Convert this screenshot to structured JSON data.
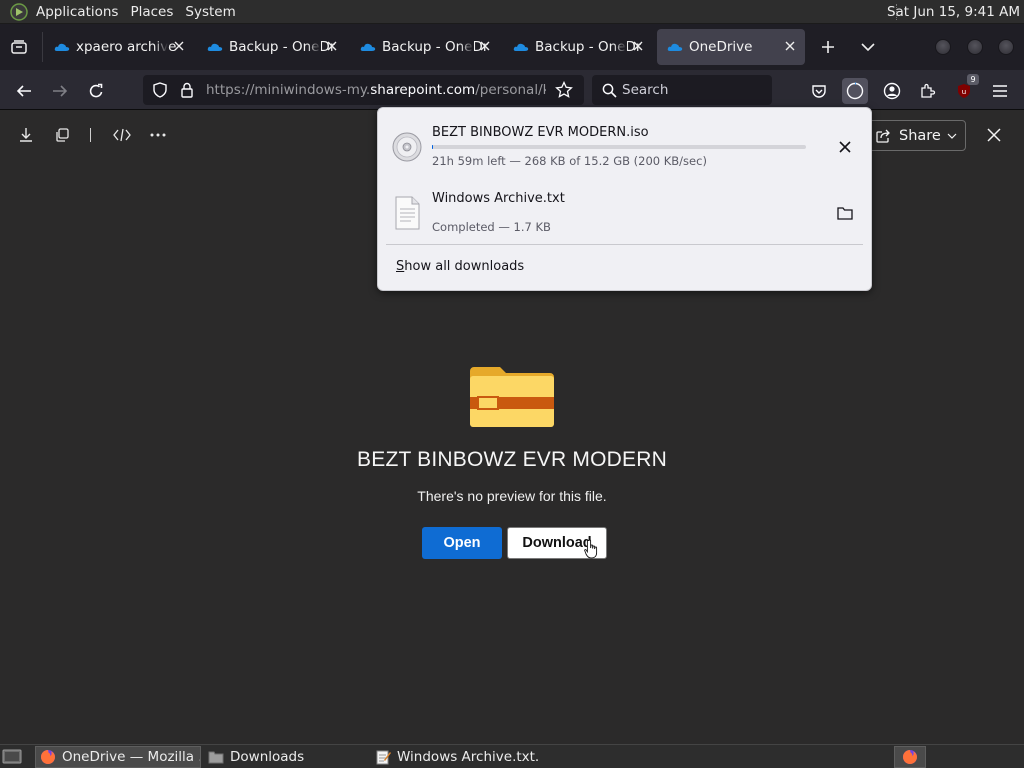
{
  "system_panel": {
    "menus": [
      "Applications",
      "Places",
      "System"
    ],
    "clock": "Sat Jun 15,  9:41 AM"
  },
  "tabs": [
    {
      "title": "xpaero archive",
      "active": false
    },
    {
      "title": "Backup - OneDrive",
      "active": false
    },
    {
      "title": "Backup - OneDrive",
      "active": false
    },
    {
      "title": "Backup - OneDrive",
      "active": false
    },
    {
      "title": "OneDrive",
      "active": true
    }
  ],
  "navbar": {
    "url_prefix": "https://miniwindows-my.",
    "url_domain": "sharepoint.com",
    "url_path": "/personal/koz",
    "search_placeholder": "Search",
    "ublock_badge": "9"
  },
  "viewer": {
    "share_label": "Share",
    "file_name": "BEZT BINBOWZ EVR MODERN",
    "no_preview_text": "There's no preview for this file.",
    "open_label": "Open",
    "download_label": "Download"
  },
  "downloads_panel": {
    "items": [
      {
        "name": "BEZT BINBOWZ EVR MODERN.iso",
        "status": "21h 59m left — 268 KB of 15.2 GB (200 KB/sec)",
        "progress": 0.0017
      },
      {
        "name": "Windows Archive.txt",
        "status": "Completed — 1.7 KB"
      }
    ],
    "show_all_label_underlined": "S",
    "show_all_label_rest": "how all downloads"
  },
  "taskbar": {
    "tasks": [
      {
        "label": "OneDrive — Mozilla ...",
        "active": true
      },
      {
        "label": "Downloads",
        "active": false
      },
      {
        "label": "Windows Archive.txt...",
        "active": false
      }
    ]
  },
  "colors": {
    "accent_blue": "#0f6cd3",
    "progress_blue": "#0061e0",
    "folder_yellow": "#fcd765",
    "folder_band": "#c9590f"
  }
}
